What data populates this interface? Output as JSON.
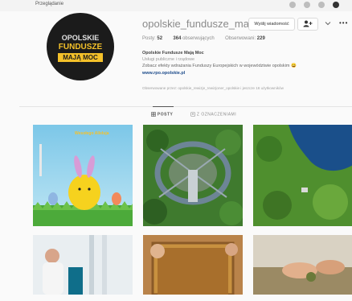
{
  "topbar": {
    "text": "Przeglądanie"
  },
  "avatar": {
    "line1": "OPOLSKIE",
    "line2": "FUNDUSZE",
    "line3": "MAJĄ MOC"
  },
  "profile": {
    "username": "opolskie_fundusze_maj...",
    "message_button": "Wyślij wiadomość",
    "follow_icon": "add-user-icon",
    "more_icon": "more-icon"
  },
  "stats": {
    "posts_label": "Posty:",
    "posts_value": "52",
    "followers_value": "364",
    "followers_label": "obserwujących",
    "following_label": "Obserwowani:",
    "following_value": "229"
  },
  "bio": {
    "name": "Opolskie Fundusze Mają Moc",
    "category": "Usługi publiczne i rządowe",
    "description": "Zobacz efekty wdrażania Funduszy Europejskich w województwie opolskim 😀",
    "link": "www.rpo.opolskie.pl",
    "followed_by": "Obserwowane przez: opolskie_rewizje_rewizjoner_opolskie i jeszcze 16 użytkowników"
  },
  "tabs": [
    {
      "label": "POSTY",
      "active": true
    },
    {
      "label": "Z OZNACZENIAMI",
      "active": false
    }
  ],
  "grid": {
    "post1_caption": "Wesołego Alleluja"
  },
  "colors": {
    "brand_yellow": "#f4c12a",
    "brand_dark": "#1b1b1b",
    "link": "#1b4a8a"
  }
}
